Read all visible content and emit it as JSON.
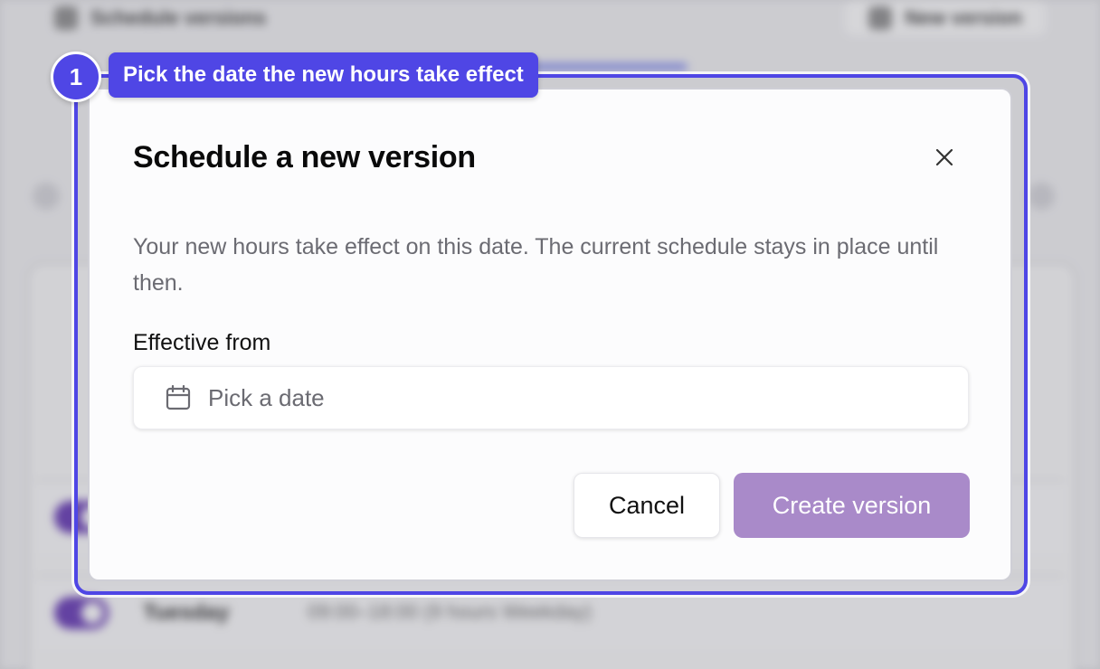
{
  "background": {
    "topbar_left_label": "Schedule versions",
    "topbar_right_label": "New version",
    "rows": [
      {
        "title": "",
        "detail": ""
      },
      {
        "title": "Tuesday",
        "detail": "09:00–18:00 (9 hours Weekday)"
      }
    ]
  },
  "tour": {
    "step_number": "1",
    "step_text": "Pick the date the new hours take effect",
    "accent_color": "#4f46e5"
  },
  "dialog": {
    "title": "Schedule a new version",
    "description": "Your new hours take effect on this date. The current schedule stays in place until then.",
    "field_label": "Effective from",
    "date_placeholder": "Pick a date",
    "cancel_label": "Cancel",
    "create_label": "Create version",
    "create_color": "#a98ac9",
    "icons": {
      "close": "close-icon",
      "date": "calendar-icon"
    }
  }
}
